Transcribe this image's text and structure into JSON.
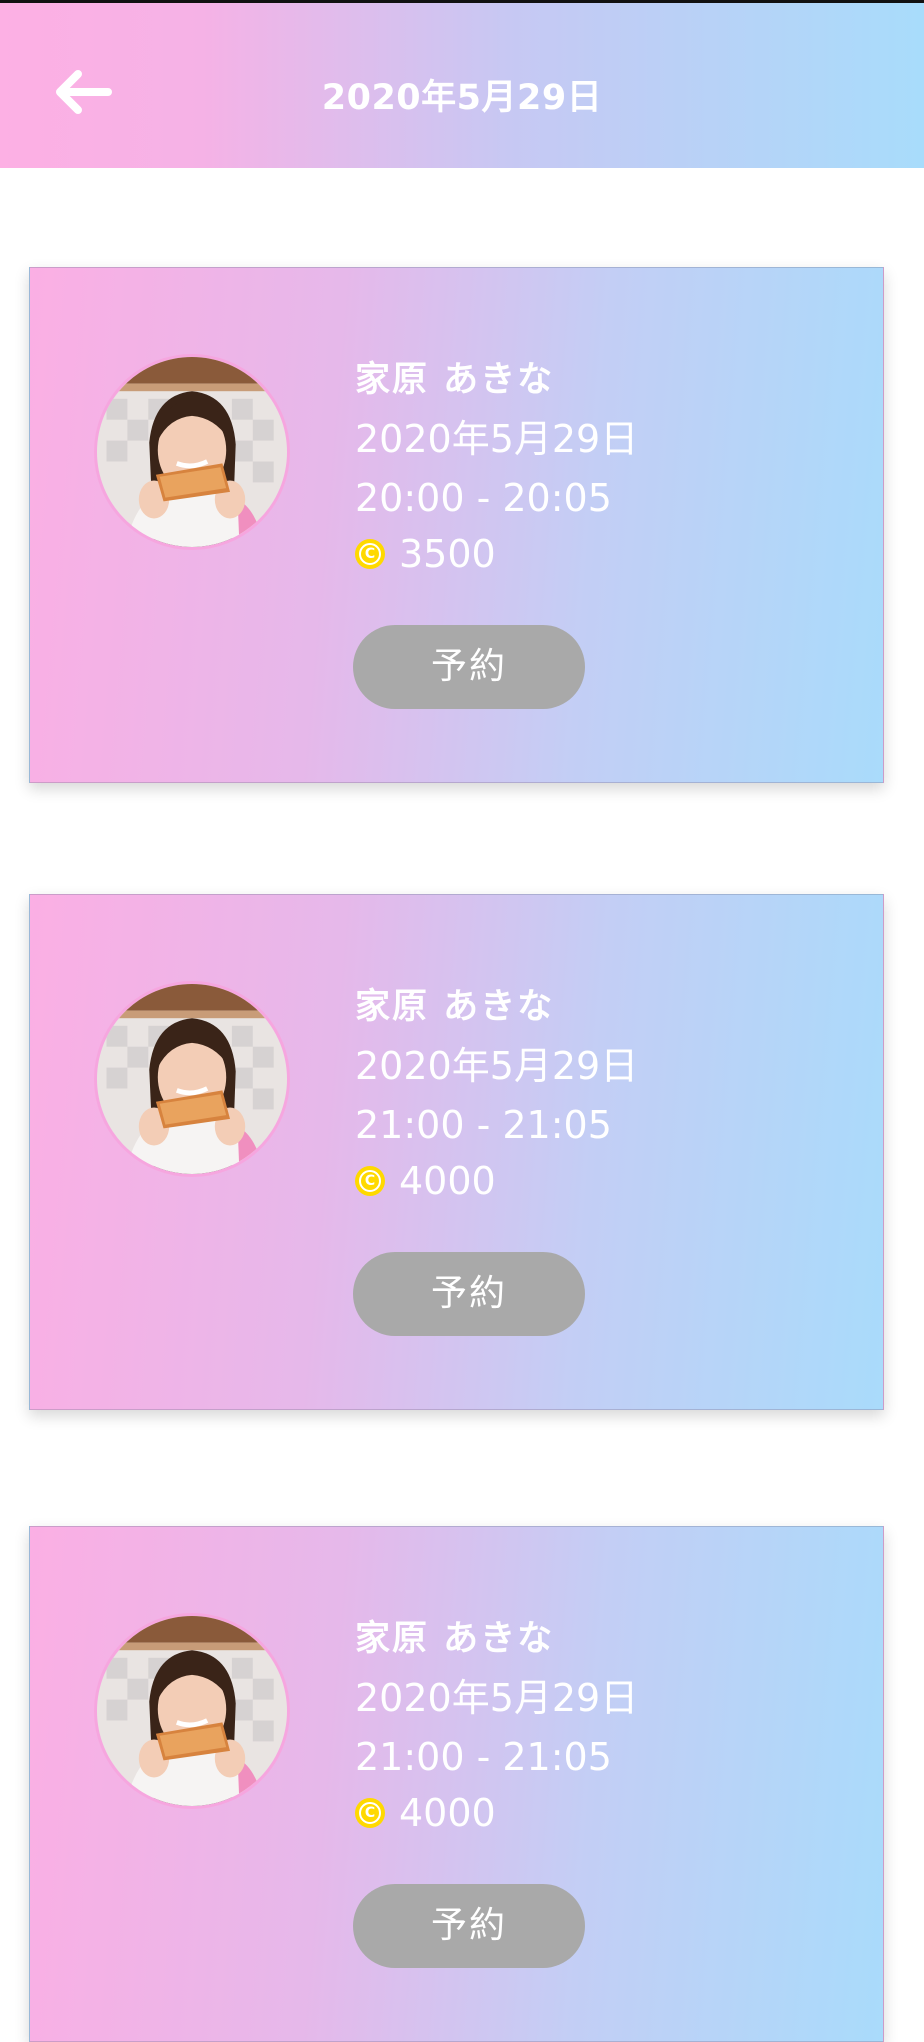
{
  "header": {
    "title": "2020年5月29日"
  },
  "colors": {
    "coin": "#ffd900",
    "button": "#a9a9a9",
    "gradient_start": "#fbafe4",
    "gradient_end": "#a9dbfb"
  },
  "slots": [
    {
      "name": "家原 あきな",
      "date": "2020年5月29日",
      "time": "20:00 - 20:05",
      "price": "3500",
      "button": "予約",
      "coin_icon": "coin-icon"
    },
    {
      "name": "家原 あきな",
      "date": "2020年5月29日",
      "time": "21:00 - 21:05",
      "price": "4000",
      "button": "予約",
      "coin_icon": "coin-icon"
    },
    {
      "name": "家原 あきな",
      "date": "2020年5月29日",
      "time": "21:00 - 21:05",
      "price": "4000",
      "button": "予約",
      "coin_icon": "coin-icon"
    }
  ]
}
